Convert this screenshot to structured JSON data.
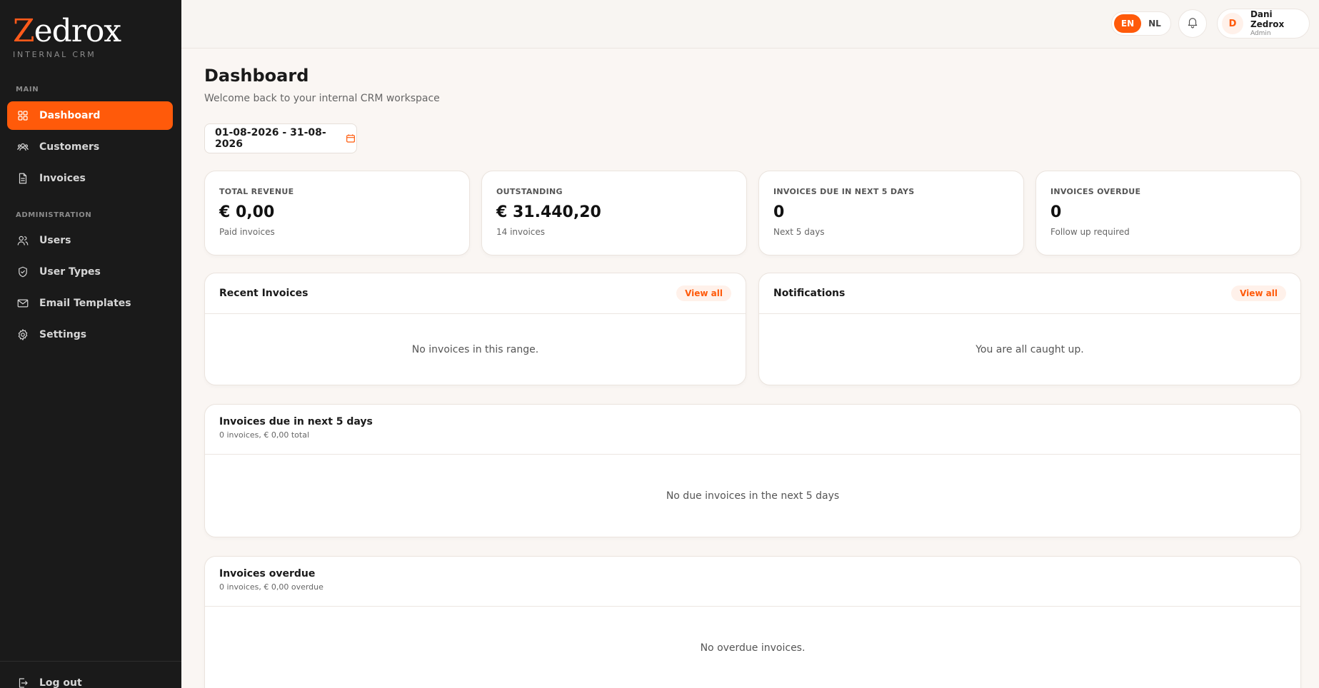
{
  "brand": {
    "logo_first": "Z",
    "logo_rest": "edrox",
    "subtitle": "INTERNAL CRM"
  },
  "sidebar": {
    "main_label": "MAIN",
    "admin_label": "ADMINISTRATION",
    "main_items": [
      {
        "label": "Dashboard",
        "icon": "grid-icon",
        "active": true
      },
      {
        "label": "Customers",
        "icon": "customers-icon"
      },
      {
        "label": "Invoices",
        "icon": "document-icon"
      }
    ],
    "admin_items": [
      {
        "label": "Users",
        "icon": "users-icon"
      },
      {
        "label": "User Types",
        "icon": "shield-icon"
      },
      {
        "label": "Email Templates",
        "icon": "mail-icon"
      },
      {
        "label": "Settings",
        "icon": "gear-icon"
      }
    ],
    "logout_label": "Log out"
  },
  "topbar": {
    "lang_options": [
      "EN",
      "NL"
    ],
    "lang_active": "EN",
    "user_initial": "D",
    "user_name": "Dani Zedrox",
    "user_role": "Admin"
  },
  "page": {
    "title": "Dashboard",
    "subtitle": "Welcome back to your internal CRM workspace",
    "date_range": "01-08-2026 - 31-08-2026"
  },
  "stats": [
    {
      "label": "TOTAL REVENUE",
      "value": "€ 0,00",
      "hint": "Paid invoices"
    },
    {
      "label": "OUTSTANDING",
      "value": "€ 31.440,20",
      "hint": "14 invoices"
    },
    {
      "label": "INVOICES DUE IN NEXT 5 DAYS",
      "value": "0",
      "hint": "Next 5 days"
    },
    {
      "label": "INVOICES OVERDUE",
      "value": "0",
      "hint": "Follow up required"
    }
  ],
  "recent_invoices": {
    "title": "Recent Invoices",
    "view_all": "View all",
    "empty": "No invoices in this range."
  },
  "notifications": {
    "title": "Notifications",
    "view_all": "View all",
    "empty": "You are all caught up."
  },
  "due_next": {
    "title": "Invoices due in next 5 days",
    "summary": "0 invoices, € 0,00 total",
    "empty": "No due invoices in the next 5 days"
  },
  "overdue": {
    "title": "Invoices overdue",
    "summary": "0 invoices, € 0,00 overdue",
    "empty": "No overdue invoices."
  },
  "colors": {
    "accent": "#ff5a0a",
    "sidebar_bg": "#1a1a1a",
    "page_bg": "#faf6f3"
  }
}
